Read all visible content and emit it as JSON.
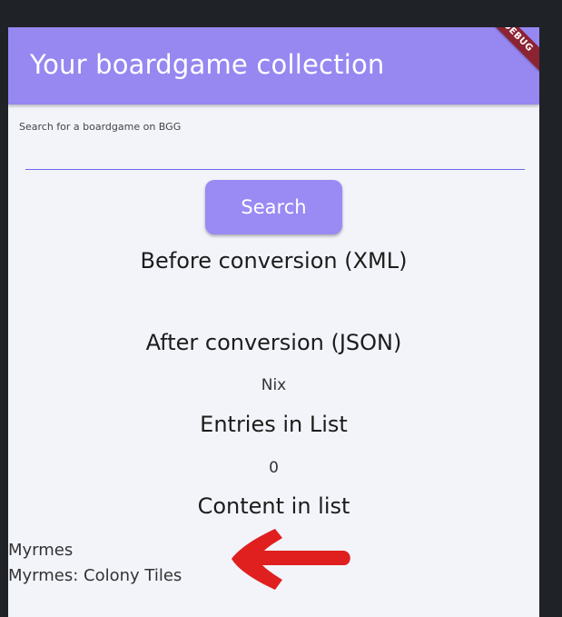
{
  "app_bar": {
    "title": "Your boardgame collection",
    "debug_label": "DEBUG"
  },
  "search": {
    "label": "Search for a boardgame on BGG",
    "value": "",
    "button_label": "Search"
  },
  "sections": {
    "before_conversion": "Before conversion (XML)",
    "after_conversion": "After conversion (JSON)",
    "after_value": "Nix",
    "entries_heading": "Entries in List",
    "entries_count": "0",
    "content_heading": "Content in list"
  },
  "list_items": [
    "Myrmes",
    "Myrmes: Colony Tiles"
  ],
  "colors": {
    "app_bar": "#9687f1",
    "button": "#9a8af3",
    "background": "#f2f4fa",
    "debug_banner": "#8c2332",
    "annotation_arrow": "#e01f1f"
  }
}
